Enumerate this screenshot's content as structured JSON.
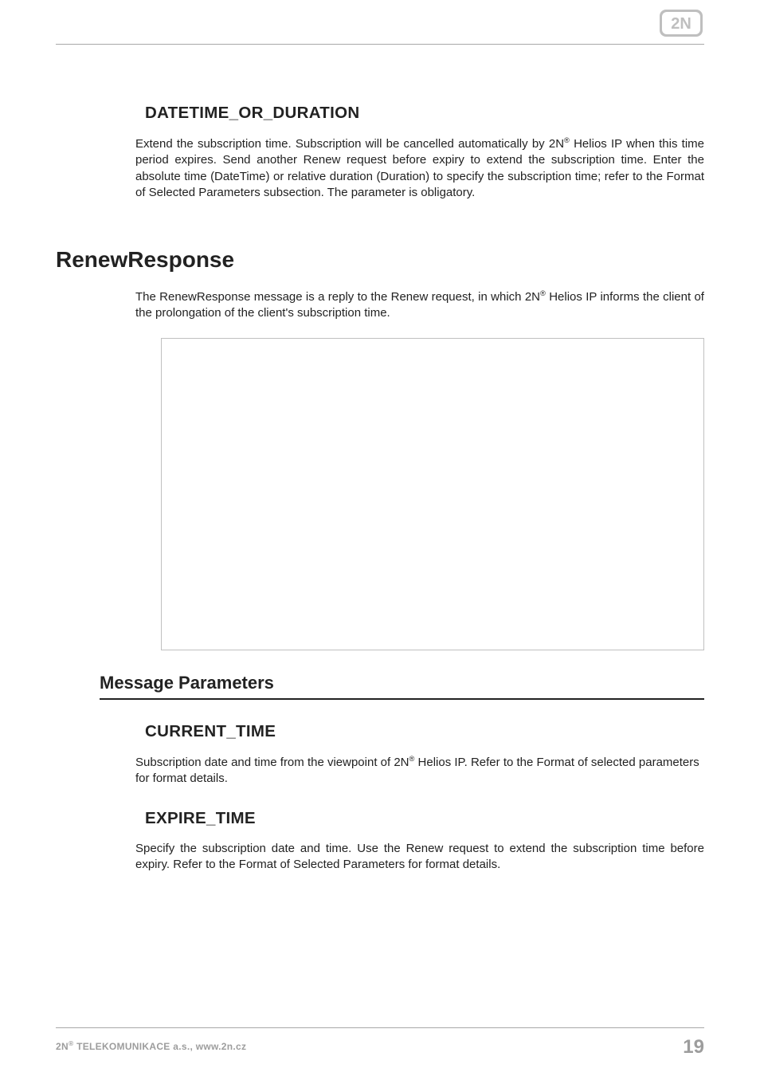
{
  "header": {
    "logo_alt": "2N"
  },
  "sections": {
    "dt_dur": {
      "heading": "DATETIME_OR_DURATION",
      "p_a": "Extend the subscription time. Subscription will be cancelled automatically by 2N",
      "p_b": " Helios IP when this time period expires. Send another Renew request before expiry to extend the subscription time. Enter the absolute time (DateTime) or relative duration (Duration) to specify the subscription time; refer to the Format of Selected Parameters subsection. The parameter is obligatory."
    },
    "renew": {
      "heading": "RenewResponse",
      "intro_a": "The RenewResponse message is a reply to the Renew request, in which 2N",
      "intro_b": " Helios IP informs the client of the prolongation of the client's subscription time."
    },
    "mp": {
      "heading": "Message Parameters"
    },
    "current_time": {
      "heading": "CURRENT_TIME",
      "p_a": "Subscription date and time from the viewpoint of 2N",
      "p_b": " Helios IP. Refer to the Format of selected parameters for format details."
    },
    "expire_time": {
      "heading": "EXPIRE_TIME",
      "p": "Specify the subscription date and time. Use the Renew request to extend the subscription time before expiry. Refer to the Format of Selected Parameters for format details."
    }
  },
  "footer": {
    "left_a": "2N",
    "left_b": " TELEKOMUNIKACE a.s., www.2n.cz",
    "page_number": "19"
  },
  "reg_mark": "®"
}
